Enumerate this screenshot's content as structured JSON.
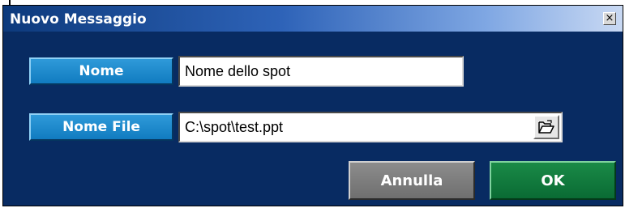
{
  "window": {
    "title": "Nuovo Messaggio",
    "close_glyph": "×"
  },
  "form": {
    "name_label": "Nome",
    "name_value": "Nome dello spot",
    "file_label": "Nome File",
    "file_value": "C:\\spot\\test.ppt",
    "browse_icon": "folder-open-icon"
  },
  "buttons": {
    "cancel_label": "Annulla",
    "ok_label": "OK"
  },
  "colors": {
    "window_background": "#082b62",
    "label_blue": "#1a86cc",
    "cancel_gray": "#7d7d7d",
    "ok_green": "#0f7a3d"
  }
}
